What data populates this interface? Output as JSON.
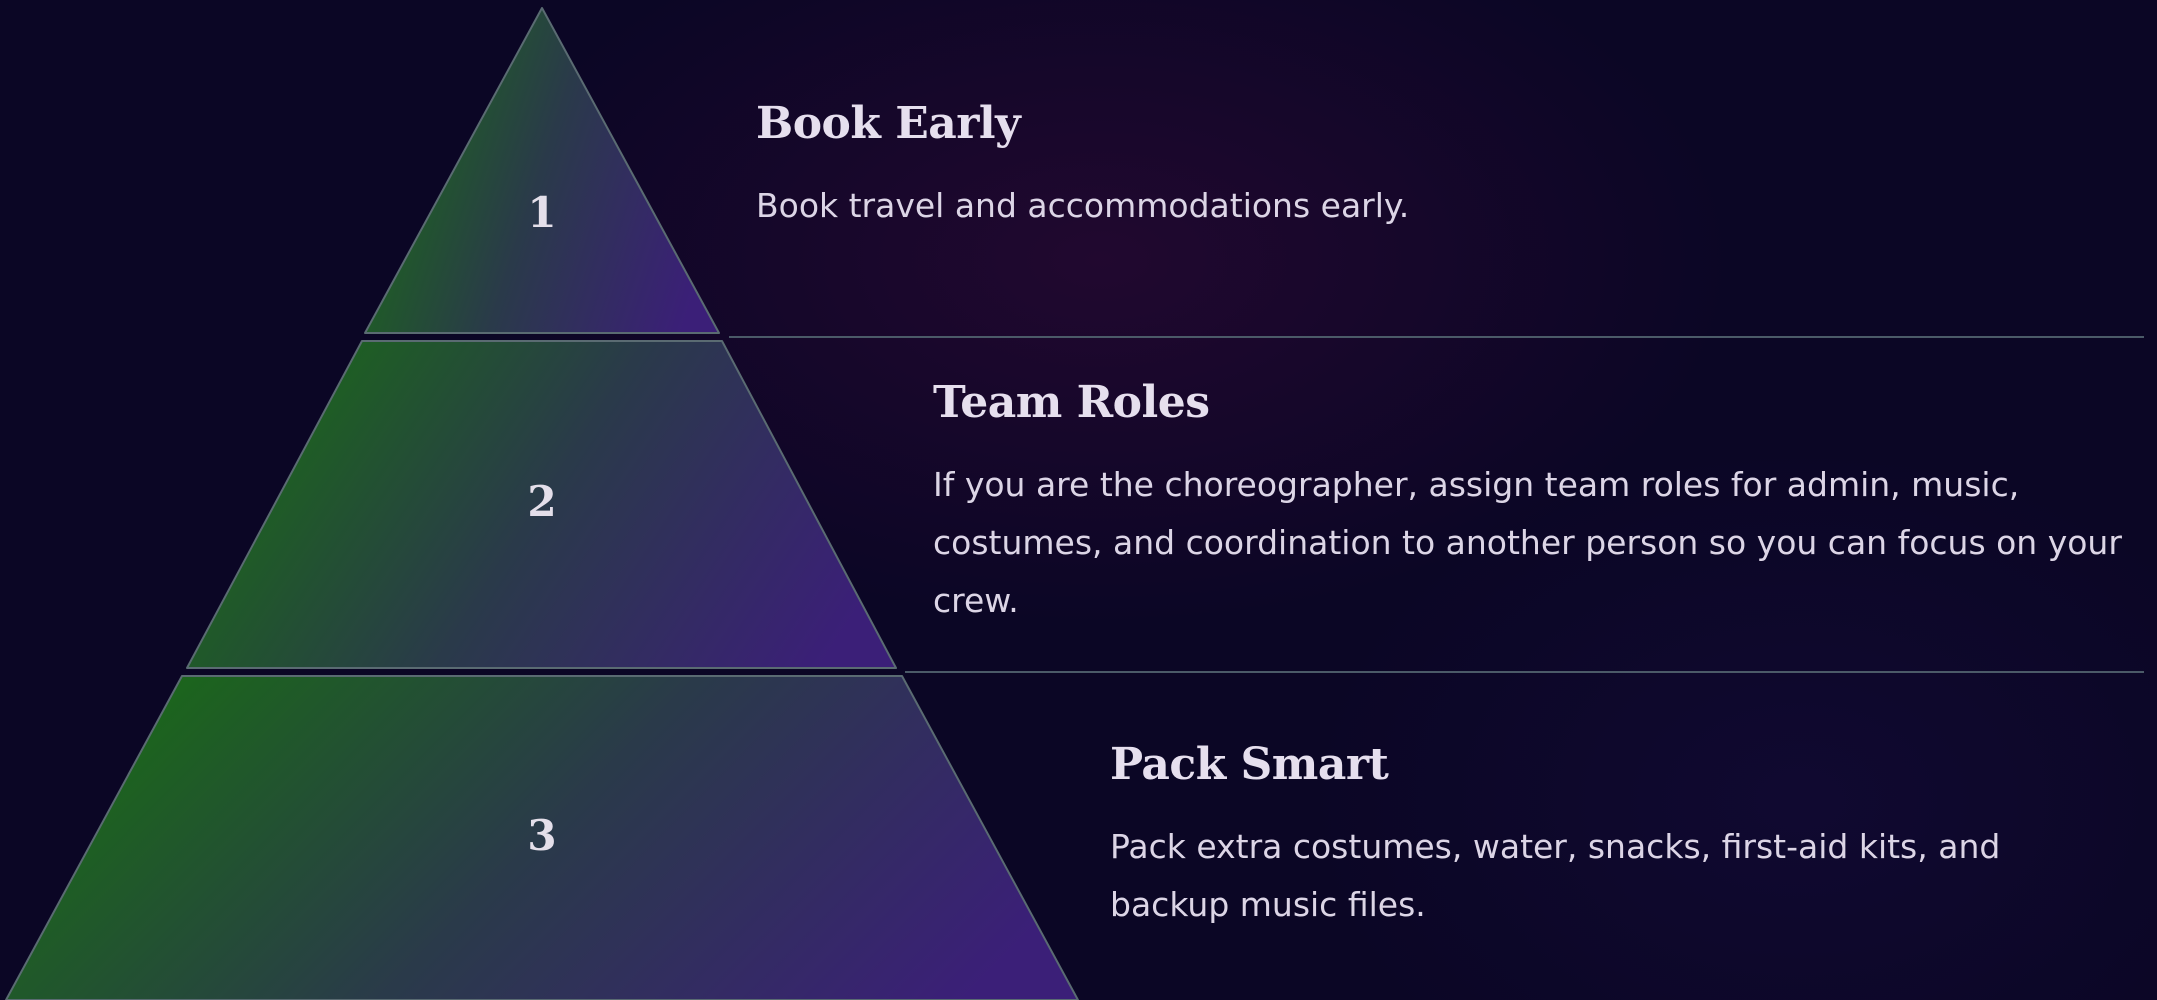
{
  "colors": {
    "background": "#0b0625",
    "gradient_start": "#1a6a17",
    "gradient_mid": "#2a3a4a",
    "gradient_end": "#3b1f78",
    "tier_stroke": "#5a6b72",
    "divider": "#4b5a68"
  },
  "steps": [
    {
      "number": "1",
      "title": "Book Early",
      "description": "Book travel and accommodations early."
    },
    {
      "number": "2",
      "title": "Team Roles",
      "description": "If you are the choreographer, assign team roles for admin, music, costumes, and coordination to another person so you can focus on your crew."
    },
    {
      "number": "3",
      "title": "Pack Smart",
      "description": "Pack extra costumes, water, snacks, first-aid kits, and backup music files."
    }
  ]
}
